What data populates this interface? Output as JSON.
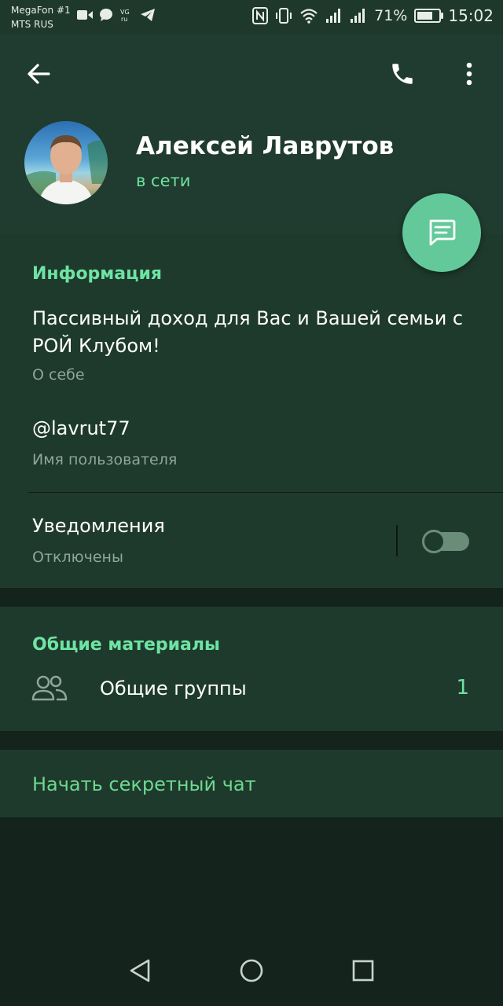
{
  "status_bar": {
    "carrier1": "MegaFon #1",
    "carrier2": "MTS RUS",
    "battery_percent": "71%",
    "battery_level": 0.71,
    "time": "15:02"
  },
  "header": {
    "name": "Алексей Лаврутов",
    "status": "в сети"
  },
  "info": {
    "title": "Информация",
    "bio": "Пассивный доход для Вас и Вашей семьи с РОЙ Клубом!",
    "bio_caption": "О себе",
    "username": "@lavrut77",
    "username_caption": "Имя пользователя",
    "notifications_label": "Уведомления",
    "notifications_state": "Отключены",
    "notifications_enabled": false
  },
  "shared": {
    "title": "Общие материалы",
    "groups_label": "Общие группы",
    "groups_count": "1"
  },
  "secret_chat": {
    "label": "Начать секретный чат"
  },
  "colors": {
    "accent": "#6fe3a3",
    "fab": "#63c99a",
    "header_bg": "#203b2f",
    "section_bg": "#1e3a2c",
    "page_bg": "#14231c"
  },
  "icons": [
    "arrow-back-icon",
    "phone-icon",
    "more-vertical-icon",
    "message-icon",
    "group-icon",
    "nav-back-icon",
    "nav-home-icon",
    "nav-recents-icon"
  ]
}
